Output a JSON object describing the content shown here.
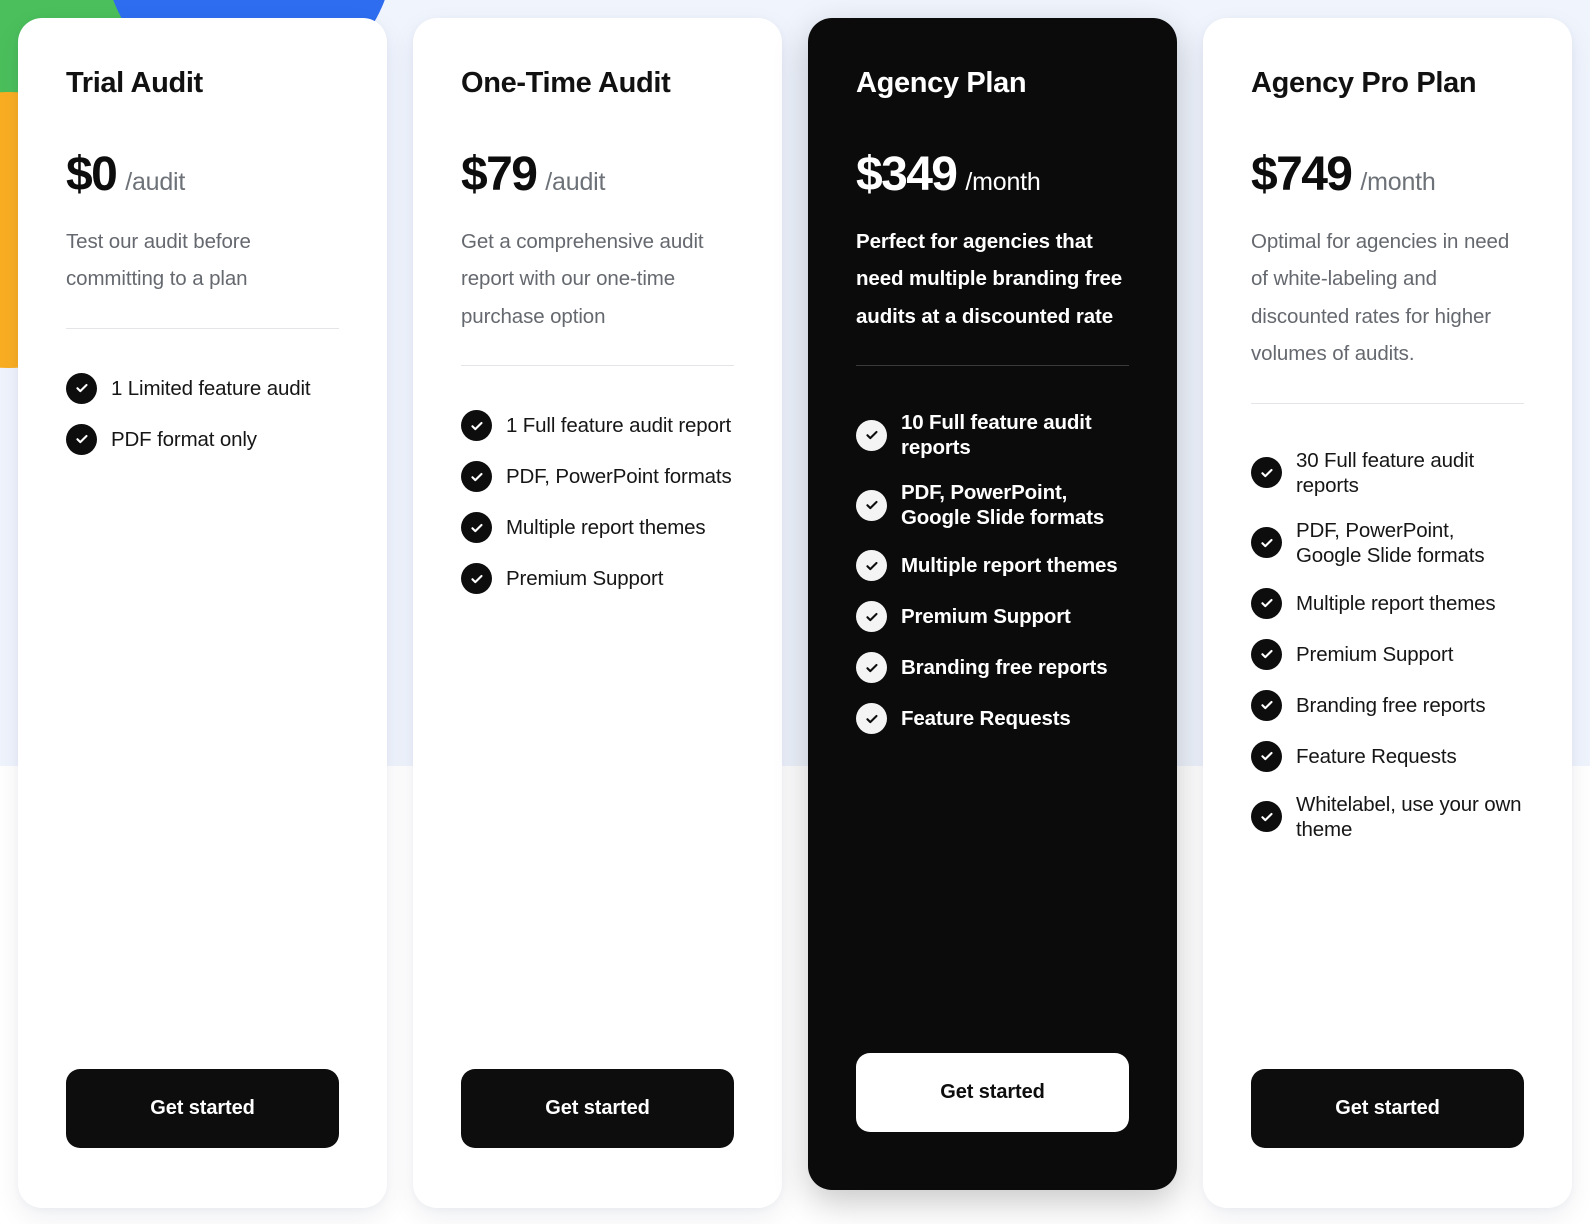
{
  "theme": {
    "page_bg_top": "#eff4fd",
    "page_bg_bottom": "#ffffff",
    "card_bg": "#ffffff",
    "featured_card_bg": "#0b0b0b",
    "accent_dark": "#0d0d0d",
    "muted_text": "#65696f",
    "decor_green": "#4bbf5c",
    "decor_blue": "#2f6df0",
    "decor_orange": "#f9ae22"
  },
  "plans": [
    {
      "name": "Trial Audit",
      "price": "$0",
      "period": "/audit",
      "description": "Test our audit before committing to a plan",
      "features": [
        "1 Limited feature audit",
        "PDF format only"
      ],
      "cta_label": "Get started",
      "featured": false
    },
    {
      "name": "One-Time Audit",
      "price": "$79",
      "period": "/audit",
      "description": "Get a comprehensive audit report with our one-time purchase option",
      "features": [
        "1 Full feature audit report",
        "PDF, PowerPoint formats",
        "Multiple report themes",
        "Premium Support"
      ],
      "cta_label": "Get started",
      "featured": false
    },
    {
      "name": "Agency Plan",
      "price": "$349",
      "period": "/month",
      "description": "Perfect for agencies that need multiple branding free audits at a discounted rate",
      "features": [
        "10 Full feature audit reports",
        "PDF, PowerPoint, Google Slide formats",
        "Multiple report themes",
        "Premium Support",
        "Branding free reports",
        "Feature Requests"
      ],
      "cta_label": "Get started",
      "featured": true
    },
    {
      "name": "Agency Pro Plan",
      "price": "$749",
      "period": "/month",
      "description": "Optimal for agencies in need of white-labeling and discounted rates for higher volumes of audits.",
      "features": [
        "30 Full feature audit reports",
        "PDF, PowerPoint, Google Slide formats",
        "Multiple report themes",
        "Premium Support",
        "Branding free reports",
        "Feature Requests",
        "Whitelabel, use your own theme"
      ],
      "cta_label": "Get started",
      "featured": false
    }
  ],
  "icons": {
    "feature_check": "check-circle-icon"
  }
}
